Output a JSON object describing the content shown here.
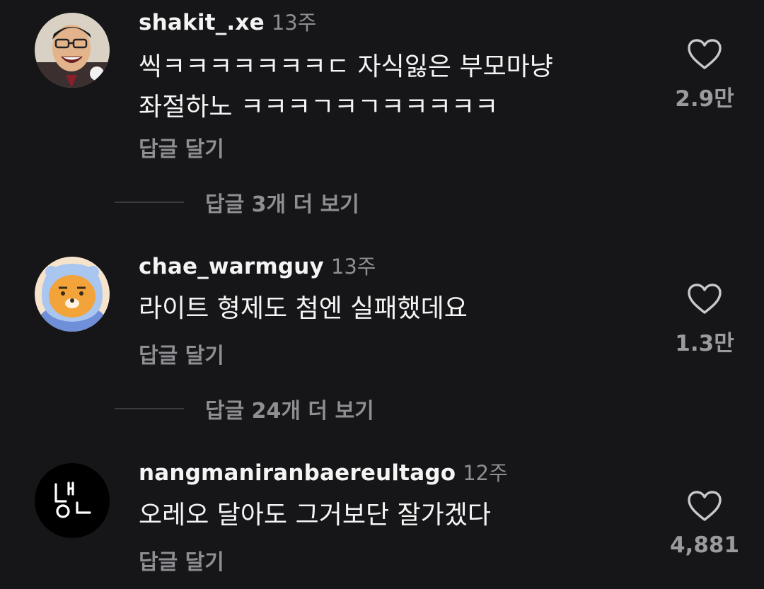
{
  "comments": [
    {
      "username": "shakit_.xe",
      "time": "13주",
      "text_lines": [
        "씩ㅋㅋㅋㅋㅋㅋㅋㄷ 자식잃은 부모마냥",
        "좌절하노 ㅋㅋㅋㄱㅋㄱㅋㅋㅋㅋㅋ"
      ],
      "reply_label": "답글 달기",
      "likes": "2.9만",
      "more_replies": "답글 3개 더 보기"
    },
    {
      "username": "chae_warmguy",
      "time": "13주",
      "text_lines": [
        "라이트 형제도 첨엔 실패했데요"
      ],
      "reply_label": "답글 달기",
      "likes": "1.3만",
      "more_replies": "답글 24개 더 보기"
    },
    {
      "username": "nangmaniranbaereultago",
      "time": "12주",
      "text_lines": [
        "오레오 달아도 그거보단 잘가겠다"
      ],
      "reply_label": "답글 달기",
      "likes": "4,881"
    }
  ],
  "colors": {
    "background": "#161618",
    "text": "#f4f4f4",
    "muted": "#8e8e93",
    "heart": "#c8c8cc"
  },
  "icons": [
    "heart-outline-icon",
    "avatar-photo",
    "avatar-character",
    "avatar-logo"
  ]
}
